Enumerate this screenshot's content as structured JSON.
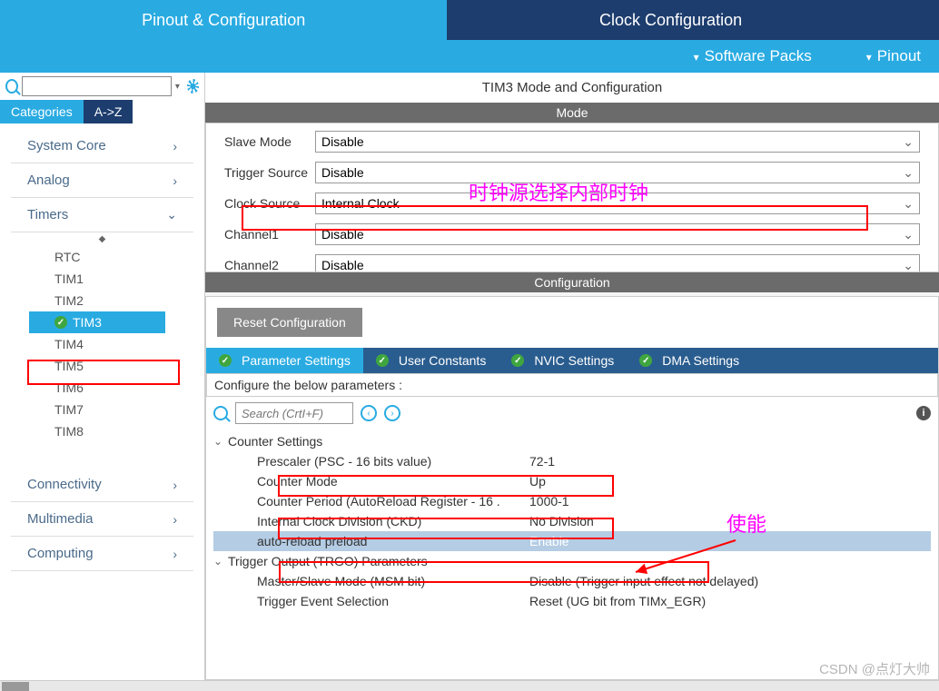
{
  "topTabs": {
    "pinout": "Pinout & Configuration",
    "clock": "Clock Configuration"
  },
  "subBar": {
    "software": "Software Packs",
    "pinout": "Pinout"
  },
  "leftTabs": {
    "categories": "Categories",
    "az": "A->Z"
  },
  "categories": {
    "system": "System Core",
    "analog": "Analog",
    "timers": "Timers",
    "connectivity": "Connectivity",
    "multimedia": "Multimedia",
    "computing": "Computing"
  },
  "timers": [
    "RTC",
    "TIM1",
    "TIM2",
    "TIM3",
    "TIM4",
    "TIM5",
    "TIM6",
    "TIM7",
    "TIM8"
  ],
  "rightTitle": "TIM3 Mode and Configuration",
  "sections": {
    "mode": "Mode",
    "config": "Configuration"
  },
  "mode": {
    "slaveLabel": "Slave Mode",
    "slaveVal": "Disable",
    "triggerLabel": "Trigger Source",
    "triggerVal": "Disable",
    "clockLabel": "Clock Source",
    "clockVal": "Internal Clock",
    "ch1Label": "Channel1",
    "ch1Val": "Disable",
    "ch2Label": "Channel2",
    "ch2Val": "Disable"
  },
  "resetBtn": "Reset Configuration",
  "cfgTabs": {
    "param": "Parameter Settings",
    "user": "User Constants",
    "nvic": "NVIC Settings",
    "dma": "DMA Settings"
  },
  "cfgDesc": "Configure the below parameters :",
  "searchPlaceholder": "Search (CrtI+F)",
  "tree": {
    "counterHdr": "Counter Settings",
    "prescaler": {
      "name": "Prescaler (PSC - 16 bits value)",
      "val": "72-1"
    },
    "counterMode": {
      "name": "Counter Mode",
      "val": "Up"
    },
    "counterPeriod": {
      "name": "Counter Period (AutoReload Register - 16 .",
      "val": "1000-1"
    },
    "ckd": {
      "name": "Internal Clock Division (CKD)",
      "val": "No Division"
    },
    "arpe": {
      "name": "auto-reload preload",
      "val": "Enable"
    },
    "trgoHdr": "Trigger Output (TRGO) Parameters",
    "msm": {
      "name": "Master/Slave Mode (MSM bit)",
      "val": "Disable (Trigger input effect not delayed)"
    },
    "trgosel": {
      "name": "Trigger Event Selection",
      "val": "Reset (UG bit from TIMx_EGR)"
    }
  },
  "annotations": {
    "clockNote": "时钟源选择内部时钟",
    "enableNote": "使能"
  },
  "watermark": "CSDN @点灯大帅"
}
